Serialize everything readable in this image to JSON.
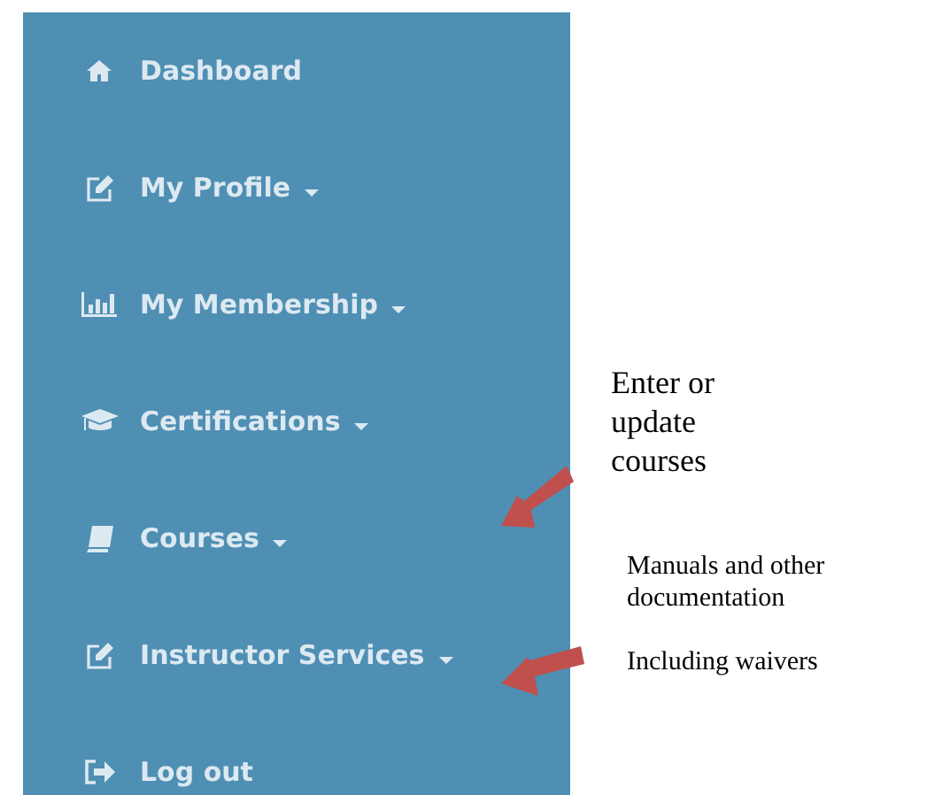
{
  "sidebar": {
    "items": [
      {
        "label": "Dashboard",
        "has_submenu": false
      },
      {
        "label": "My Profile",
        "has_submenu": true
      },
      {
        "label": "My Membership",
        "has_submenu": true
      },
      {
        "label": "Certifications",
        "has_submenu": true
      },
      {
        "label": "Courses",
        "has_submenu": true
      },
      {
        "label": "Instructor Services",
        "has_submenu": true
      },
      {
        "label": "Log out",
        "has_submenu": false
      }
    ]
  },
  "annotations": [
    {
      "paragraphs": [
        "Enter or update courses"
      ]
    },
    {
      "paragraphs": [
        "Manuals and other documentation",
        "Including waivers"
      ]
    }
  ]
}
